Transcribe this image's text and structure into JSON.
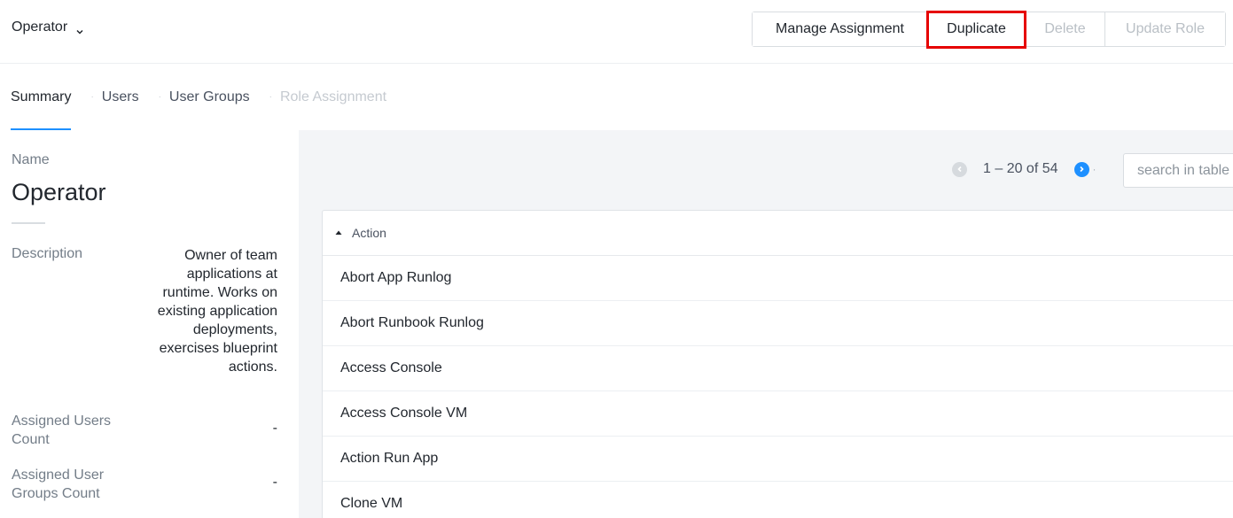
{
  "header": {
    "title": "Operator",
    "buttons": {
      "manage": "Manage Assignment",
      "duplicate": "Duplicate",
      "delete": "Delete",
      "update": "Update Role"
    }
  },
  "tabs": [
    {
      "label": "Summary",
      "active": true
    },
    {
      "label": "Users",
      "active": false
    },
    {
      "label": "User Groups",
      "active": false
    },
    {
      "label": "Role Assignment",
      "disabled": true
    }
  ],
  "summary": {
    "name_label": "Name",
    "name_value": "Operator",
    "description_label": "Description",
    "description_value": "Owner of team applications at runtime. Works on existing application deployments, exercises blueprint actions.",
    "assigned_users_label": "Assigned Users Count",
    "assigned_users_value": "-",
    "assigned_groups_label": "Assigned User Groups Count",
    "assigned_groups_value": "-"
  },
  "pagination": {
    "range": "1 – 20 of 54"
  },
  "search": {
    "placeholder": "search in table"
  },
  "table": {
    "column": "Action",
    "rows": [
      "Abort App Runlog",
      "Abort Runbook Runlog",
      "Access Console",
      "Access Console VM",
      "Action Run App",
      "Clone VM"
    ]
  },
  "colors": {
    "accent": "#1e90ff",
    "highlight": "#e60000"
  }
}
